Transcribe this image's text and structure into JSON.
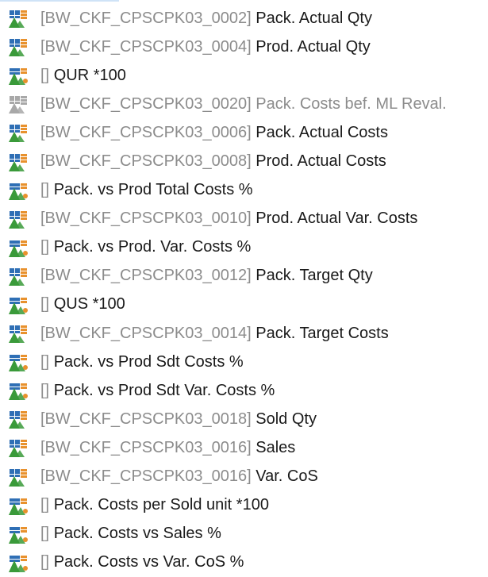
{
  "tree": {
    "items": [
      {
        "code": "[BW_CKF_CPSCPK03_0002]",
        "name": "Pack. Actual Qty",
        "icon": "key-figure-icon",
        "state": "active"
      },
      {
        "code": "[BW_CKF_CPSCPK03_0004]",
        "name": "Prod. Actual Qty",
        "icon": "key-figure-icon",
        "state": "active"
      },
      {
        "code": "[]",
        "name": "QUR *100",
        "icon": "calculated-key-figure-icon",
        "state": "active"
      },
      {
        "code": "[BW_CKF_CPSCPK03_0020]",
        "name": "Pack. Costs bef. ML Reval.",
        "icon": "key-figure-icon",
        "state": "disabled"
      },
      {
        "code": "[BW_CKF_CPSCPK03_0006]",
        "name": "Pack. Actual Costs",
        "icon": "key-figure-icon",
        "state": "active"
      },
      {
        "code": "[BW_CKF_CPSCPK03_0008]",
        "name": "Prod. Actual Costs",
        "icon": "key-figure-icon",
        "state": "active"
      },
      {
        "code": "[]",
        "name": "Pack. vs Prod Total Costs %",
        "icon": "calculated-key-figure-icon",
        "state": "active"
      },
      {
        "code": "[BW_CKF_CPSCPK03_0010]",
        "name": "Prod. Actual Var. Costs",
        "icon": "key-figure-icon",
        "state": "active"
      },
      {
        "code": "[]",
        "name": "Pack. vs  Prod. Var. Costs %",
        "icon": "calculated-key-figure-icon",
        "state": "active"
      },
      {
        "code": "[BW_CKF_CPSCPK03_0012]",
        "name": "Pack. Target Qty",
        "icon": "key-figure-icon",
        "state": "active"
      },
      {
        "code": "[]",
        "name": "QUS *100",
        "icon": "calculated-key-figure-icon",
        "state": "active"
      },
      {
        "code": "[BW_CKF_CPSCPK03_0014]",
        "name": "Pack. Target Costs",
        "icon": "key-figure-icon",
        "state": "active"
      },
      {
        "code": "[]",
        "name": "Pack. vs Prod Sdt Costs %",
        "icon": "calculated-key-figure-icon",
        "state": "active"
      },
      {
        "code": "[]",
        "name": "Pack. vs Prod Sdt Var. Costs %",
        "icon": "calculated-key-figure-icon",
        "state": "active"
      },
      {
        "code": "[BW_CKF_CPSCPK03_0018]",
        "name": "Sold Qty",
        "icon": "key-figure-icon",
        "state": "active"
      },
      {
        "code": "[BW_CKF_CPSCPK03_0016]",
        "name": "Sales",
        "icon": "key-figure-icon",
        "state": "active"
      },
      {
        "code": "[BW_CKF_CPSCPK03_0016]",
        "name": "Var. CoS",
        "icon": "key-figure-icon",
        "state": "active"
      },
      {
        "code": "[]",
        "name": "Pack. Costs per Sold unit *100",
        "icon": "calculated-key-figure-icon",
        "state": "active"
      },
      {
        "code": "[]",
        "name": "Pack. Costs vs Sales %",
        "icon": "calculated-key-figure-icon",
        "state": "active"
      },
      {
        "code": "[]",
        "name": "Pack. Costs vs Var. CoS %",
        "icon": "calculated-key-figure-icon",
        "state": "active"
      }
    ]
  },
  "colors": {
    "code_text": "#8c8c8c",
    "name_text": "#1a1a1a",
    "icon_blue": "#2f6fb5",
    "icon_green": "#3a9a3a",
    "icon_orange": "#e8912d",
    "icon_disabled": "#a8a8a8"
  }
}
